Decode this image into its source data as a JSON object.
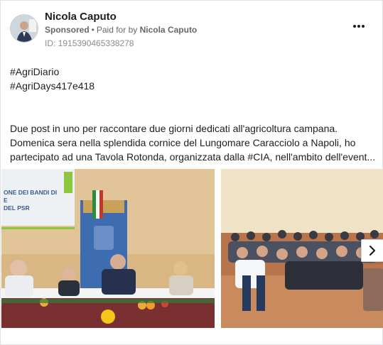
{
  "post": {
    "author": "Nicola Caputo",
    "sponsored_label": "Sponsored",
    "paid_prefix": "Paid for by",
    "paid_by": "Nicola Caputo",
    "id_line": "ID: 1915390465338278",
    "hashtags": [
      "#AgriDiario",
      "#AgriDays417e418"
    ],
    "body_lines": [
      "Due post in uno per raccontare due giorni dedicati all'agricoltura campana.",
      "Domenica sera nella splendida cornice del Lungomare Caracciolo a Napoli, ho",
      "partecipato ad una Tavola Rotonda, organizzata dalla #CIA, nell'ambito dell'event..."
    ]
  },
  "photo1": {
    "screen_lines": [
      "ONE DEI BANDI DI",
      "E",
      "DEL PSR"
    ]
  },
  "colors": {
    "accent_green": "#8cc63f",
    "text_primary": "#1c1e21",
    "text_secondary": "#65676b"
  },
  "icons": {
    "more": "more-options-icon",
    "next": "chevron-right-icon"
  }
}
